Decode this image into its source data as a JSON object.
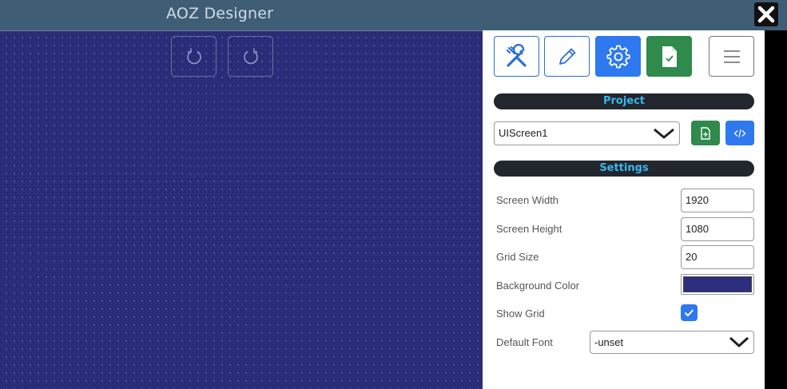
{
  "window": {
    "title": "AOZ Designer"
  },
  "colors": {
    "titlebar": "#3f5e75",
    "canvas_bg": "#2b2c78",
    "accent_blue": "#2e78f0",
    "accent_green": "#2f8a4c",
    "section_text": "#38b6ee"
  },
  "toolbar": {
    "icons": [
      "tools-icon",
      "pencil-icon",
      "gear-icon",
      "document-check-icon",
      "hamburger-menu-icon"
    ]
  },
  "history": {
    "icons": [
      "undo-icon",
      "redo-icon"
    ]
  },
  "project": {
    "header": "Project",
    "selected_screen": "UIScreen1"
  },
  "settings": {
    "header": "Settings",
    "screen_width_label": "Screen Width",
    "screen_width_value": "1920",
    "screen_height_label": "Screen Height",
    "screen_height_value": "1080",
    "grid_size_label": "Grid Size",
    "grid_size_value": "20",
    "bg_color_label": "Background Color",
    "bg_color_value": "#2c2e7e",
    "show_grid_label": "Show Grid",
    "show_grid_checked": true,
    "default_font_label": "Default Font",
    "default_font_value": "-unset"
  }
}
